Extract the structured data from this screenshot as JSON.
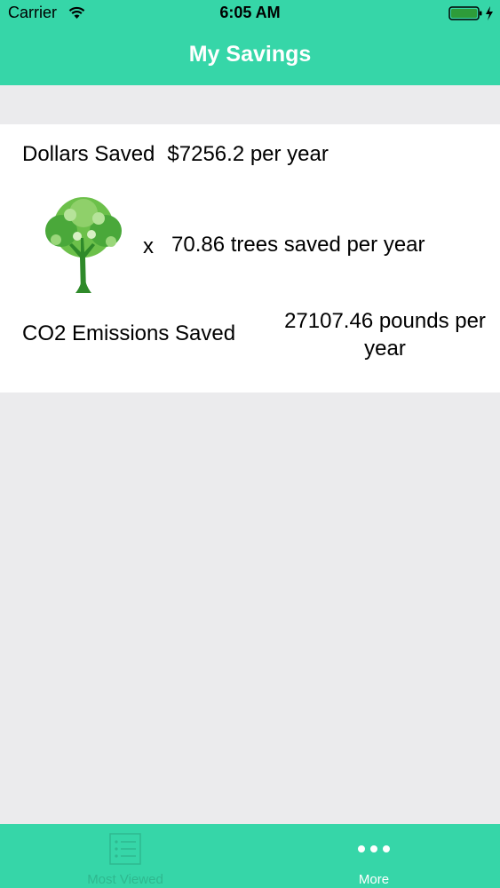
{
  "status_bar": {
    "carrier": "Carrier",
    "time": "6:05 AM",
    "icons": [
      "wifi-icon",
      "battery-icon",
      "charging-bolt-icon"
    ]
  },
  "nav": {
    "title": "My Savings"
  },
  "savings": {
    "dollars_label": "Dollars Saved",
    "dollars_value": "$7256.2 per year",
    "trees_multiplier": "x",
    "trees_value": "70.86 trees saved per year",
    "co2_label": "CO2 Emissions Saved",
    "co2_value": "27107.46 pounds per year"
  },
  "tab_bar": {
    "tabs": [
      {
        "label": "Most Viewed",
        "icon": "list-icon"
      },
      {
        "label": "More",
        "icon": "more-dots-icon"
      }
    ]
  },
  "colors": {
    "accent": "#36d6a8",
    "background": "#ebebed",
    "card": "#ffffff",
    "inactive_tab": "#2fb88f"
  }
}
